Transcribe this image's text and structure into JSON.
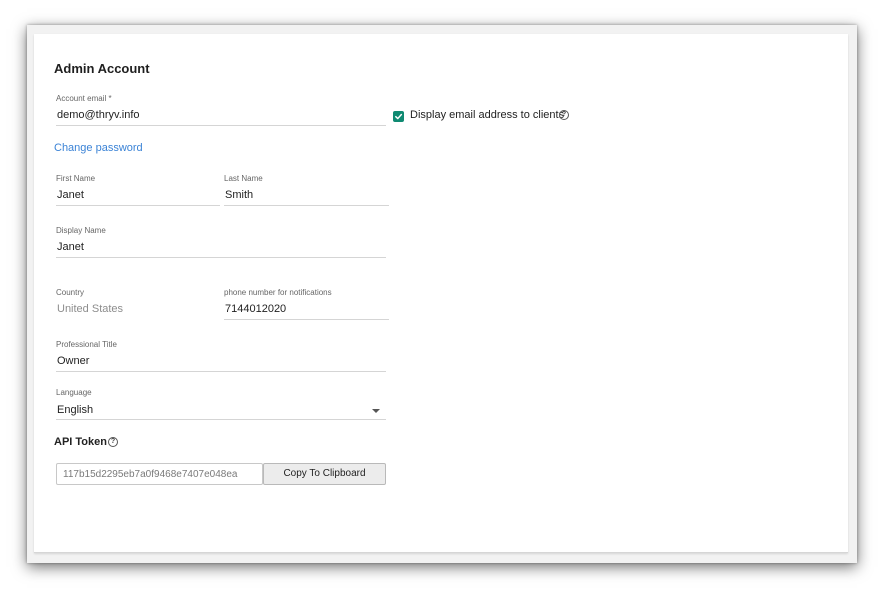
{
  "section": {
    "title": "Admin Account"
  },
  "fields": {
    "email": {
      "label": "Account email *",
      "value": "demo@thryv.info"
    },
    "display_email": {
      "label": "Display email address to clients",
      "checked": true
    },
    "change_password": "Change password",
    "first_name": {
      "label": "First Name",
      "value": "Janet"
    },
    "last_name": {
      "label": "Last Name",
      "value": "Smith"
    },
    "display_name": {
      "label": "Display Name",
      "value": "Janet"
    },
    "country": {
      "label": "Country",
      "value": "United States"
    },
    "phone": {
      "label": "phone number for notifications",
      "value": "7144012020"
    },
    "professional_title": {
      "label": "Professional Title",
      "value": "Owner"
    },
    "language": {
      "label": "Language",
      "value": "English"
    }
  },
  "api_token": {
    "title": "API Token",
    "value": "117b15d2295eb7a0f9468e7407e048ea",
    "copy_label": "Copy To Clipboard"
  },
  "icons": {
    "help": "?"
  },
  "colors": {
    "accent_link": "#3b83d6",
    "checkbox": "#0f8a72"
  }
}
